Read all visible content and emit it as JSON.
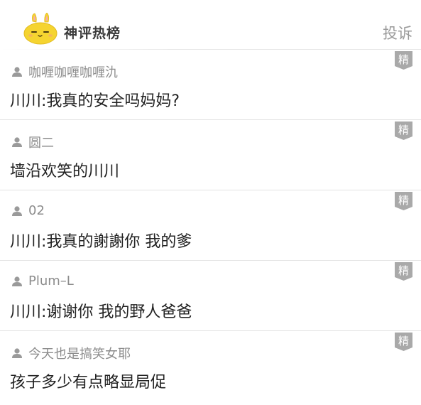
{
  "header": {
    "title": "神评热榜",
    "report_label": "投诉",
    "logo_icon": "yellow-mascot-icon"
  },
  "badge_label": "精",
  "comments": [
    {
      "user": "咖喱咖喱咖喱氿",
      "text": "川川:我真的安全吗妈妈?"
    },
    {
      "user": "圆二",
      "text": "墙沿欢笑的川川"
    },
    {
      "user": "02",
      "text": "川川:我真的謝謝你 我的爹"
    },
    {
      "user": "Plum–L",
      "text": "川川:谢谢你 我的野人爸爸"
    },
    {
      "user": "今天也是搞笑女耶",
      "text": "孩子多少有点略显局促"
    }
  ],
  "colors": {
    "accent_yellow": "#f5d430",
    "badge_gray": "#a9a9a9",
    "text_dark": "#222222",
    "text_gray": "#8c8c8c"
  }
}
